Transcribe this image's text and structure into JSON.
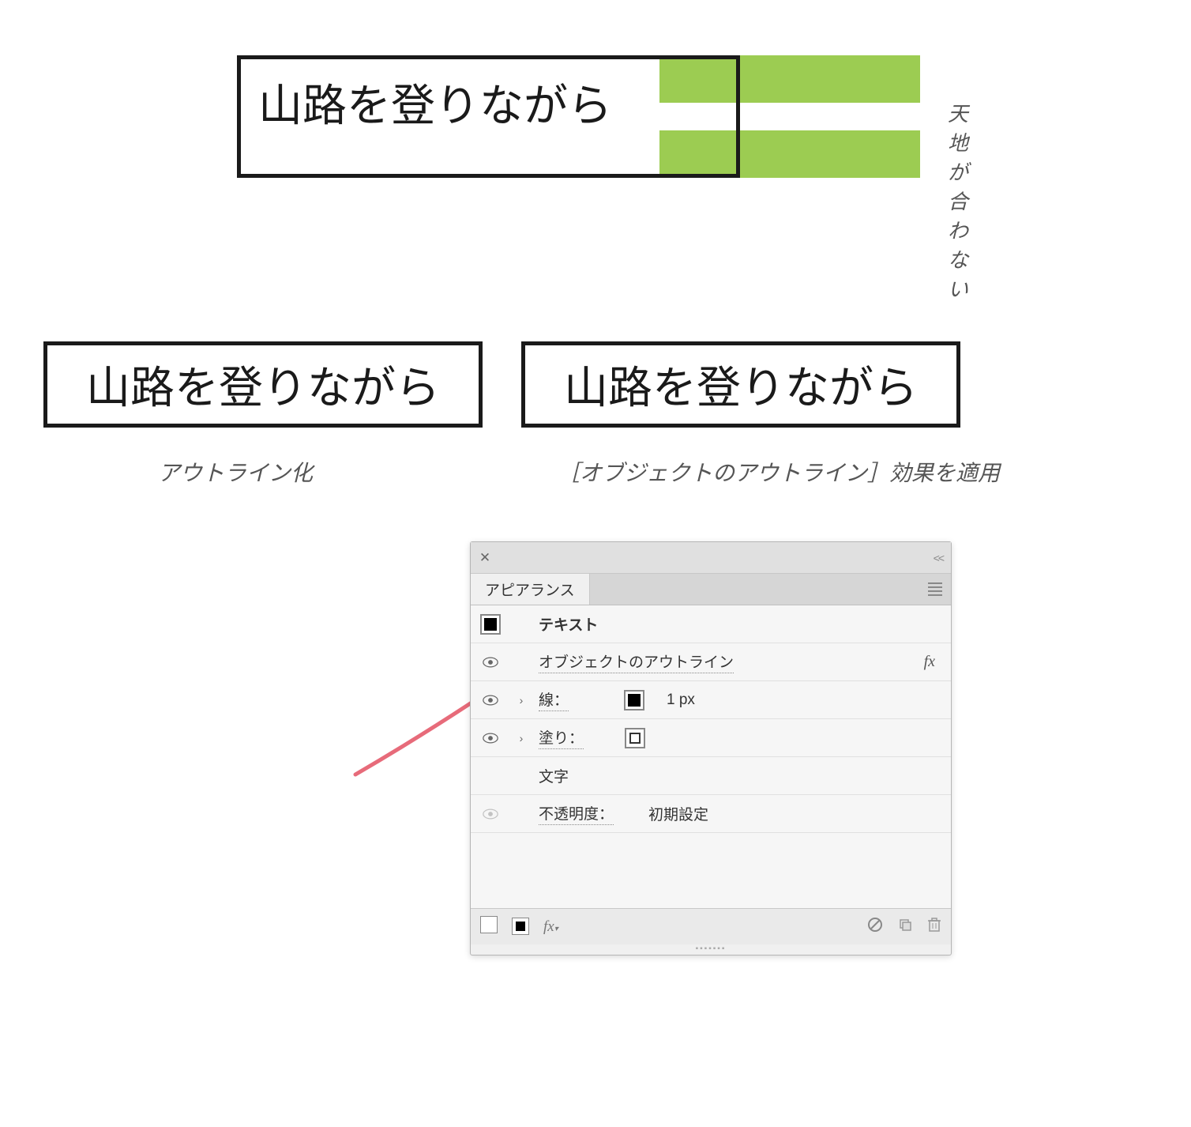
{
  "top": {
    "sample_text": "山路を登りながら",
    "annotation": "天地が合わない"
  },
  "mid": {
    "left_text": "山路を登りながら",
    "right_text": "山路を登りながら",
    "left_label": "アウトライン化",
    "right_label": "［オブジェクトのアウトライン］効果を適用"
  },
  "panel": {
    "tab_title": "アピアランス",
    "rows": {
      "text_label": "テキスト",
      "effect_label": "オブジェクトのアウトライン",
      "fx_label": "fx",
      "stroke_label": "線：",
      "stroke_value": "1 px",
      "fill_label": "塗り：",
      "characters_label": "文字",
      "opacity_label": "不透明度：",
      "opacity_value": "初期設定"
    },
    "footer": {
      "fx": "fx"
    }
  }
}
